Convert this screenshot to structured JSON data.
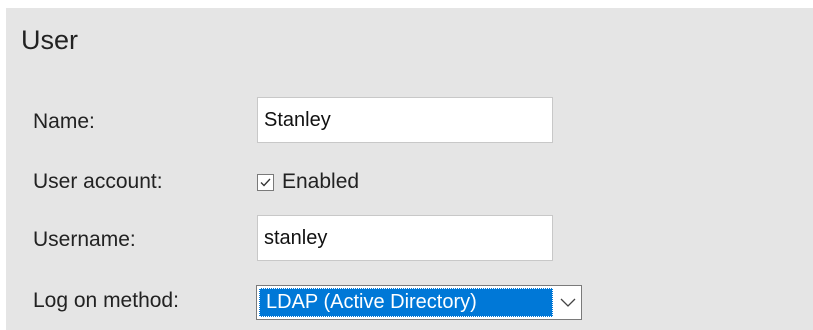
{
  "section": {
    "title": "User"
  },
  "form": {
    "name": {
      "label": "Name:",
      "value": "Stanley"
    },
    "user_account": {
      "label": "User account:",
      "checkbox_label": "Enabled",
      "checked": true
    },
    "username": {
      "label": "Username:",
      "value": "stanley"
    },
    "log_on_method": {
      "label": "Log on method:",
      "selected": "LDAP (Active Directory)"
    }
  },
  "icons": {
    "checkbox": "checkmark-icon",
    "dropdown": "chevron-down-icon"
  },
  "colors": {
    "panel_bg": "#e5e5e5",
    "selection": "#0078d7"
  }
}
